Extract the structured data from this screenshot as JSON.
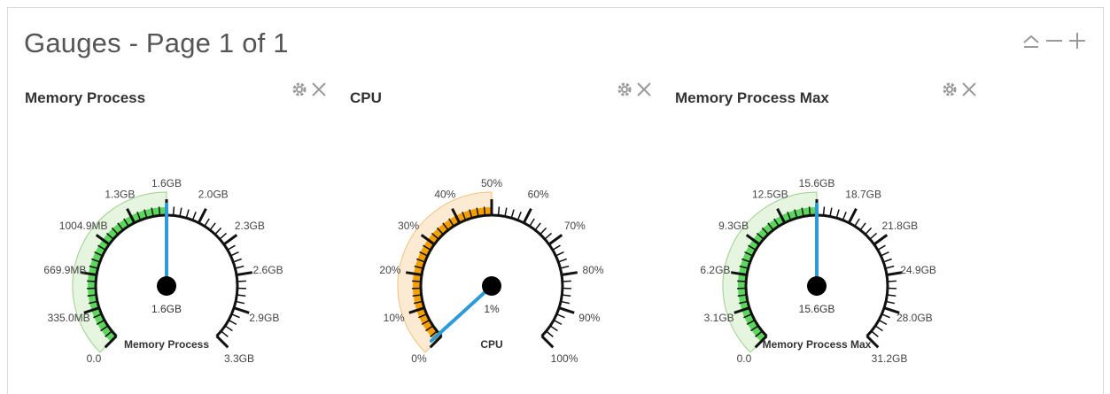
{
  "panel": {
    "title": "Gauges - Page 1 of 1",
    "controls": [
      {
        "name": "collapse-icon"
      },
      {
        "name": "minimize-icon"
      },
      {
        "name": "expand-icon"
      }
    ]
  },
  "gauges": [
    {
      "title": "Memory Process",
      "center_label": "Memory Process",
      "value_label": "1.6GB",
      "tick_labels": [
        "0.0",
        "335.0MB",
        "669.9MB",
        "1004.9MB",
        "1.3GB",
        "1.6GB",
        "2.0GB",
        "2.3GB",
        "2.6GB",
        "2.9GB",
        "3.3GB"
      ],
      "value_fraction": 0.5,
      "band_fraction": 0.5,
      "band_color": "#5cd65c",
      "band_fill": "#e6f5e0",
      "band_stroke": "#9ad08a",
      "needle_color": "#2d9bd8",
      "icons": [
        "gear-icon",
        "close-icon"
      ]
    },
    {
      "title": "CPU",
      "center_label": "CPU",
      "value_label": "1%",
      "tick_labels": [
        "0%",
        "10%",
        "20%",
        "30%",
        "40%",
        "50%",
        "60%",
        "70%",
        "80%",
        "90%",
        "100%"
      ],
      "value_fraction": 0.01,
      "band_fraction": 0.5,
      "band_color": "#f5a000",
      "band_fill": "#fcebd2",
      "band_stroke": "#f2c27a",
      "needle_color": "#2d9bd8",
      "icons": [
        "gear-icon",
        "close-icon"
      ]
    },
    {
      "title": "Memory Process Max",
      "center_label": "Memory Process Max",
      "value_label": "15.6GB",
      "tick_labels": [
        "0.0",
        "3.1GB",
        "6.2GB",
        "9.3GB",
        "12.5GB",
        "15.6GB",
        "18.7GB",
        "21.8GB",
        "24.9GB",
        "28.0GB",
        "31.2GB"
      ],
      "value_fraction": 0.5,
      "band_fraction": 0.5,
      "band_color": "#5cd65c",
      "band_fill": "#e6f5e0",
      "band_stroke": "#9ad08a",
      "needle_color": "#2d9bd8",
      "icons": [
        "gear-icon",
        "close-icon"
      ]
    }
  ]
}
